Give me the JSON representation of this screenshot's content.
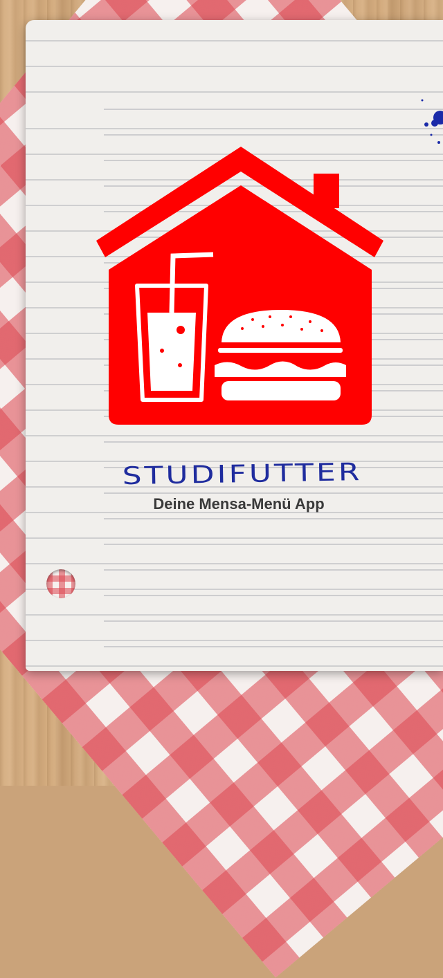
{
  "app": {
    "title": "STUDIFUTTER",
    "subtitle": "Deine Mensa-Menü App"
  },
  "icons": {
    "logo": "house-with-drink-and-burger-icon",
    "ink": "ink-splatter"
  },
  "colors": {
    "logo_red": "#ff0000",
    "title_blue": "#1f2c9e",
    "subtitle_gray": "#3a3a3a",
    "paper": "#f1efec",
    "cloth_red": "#dc4650"
  }
}
